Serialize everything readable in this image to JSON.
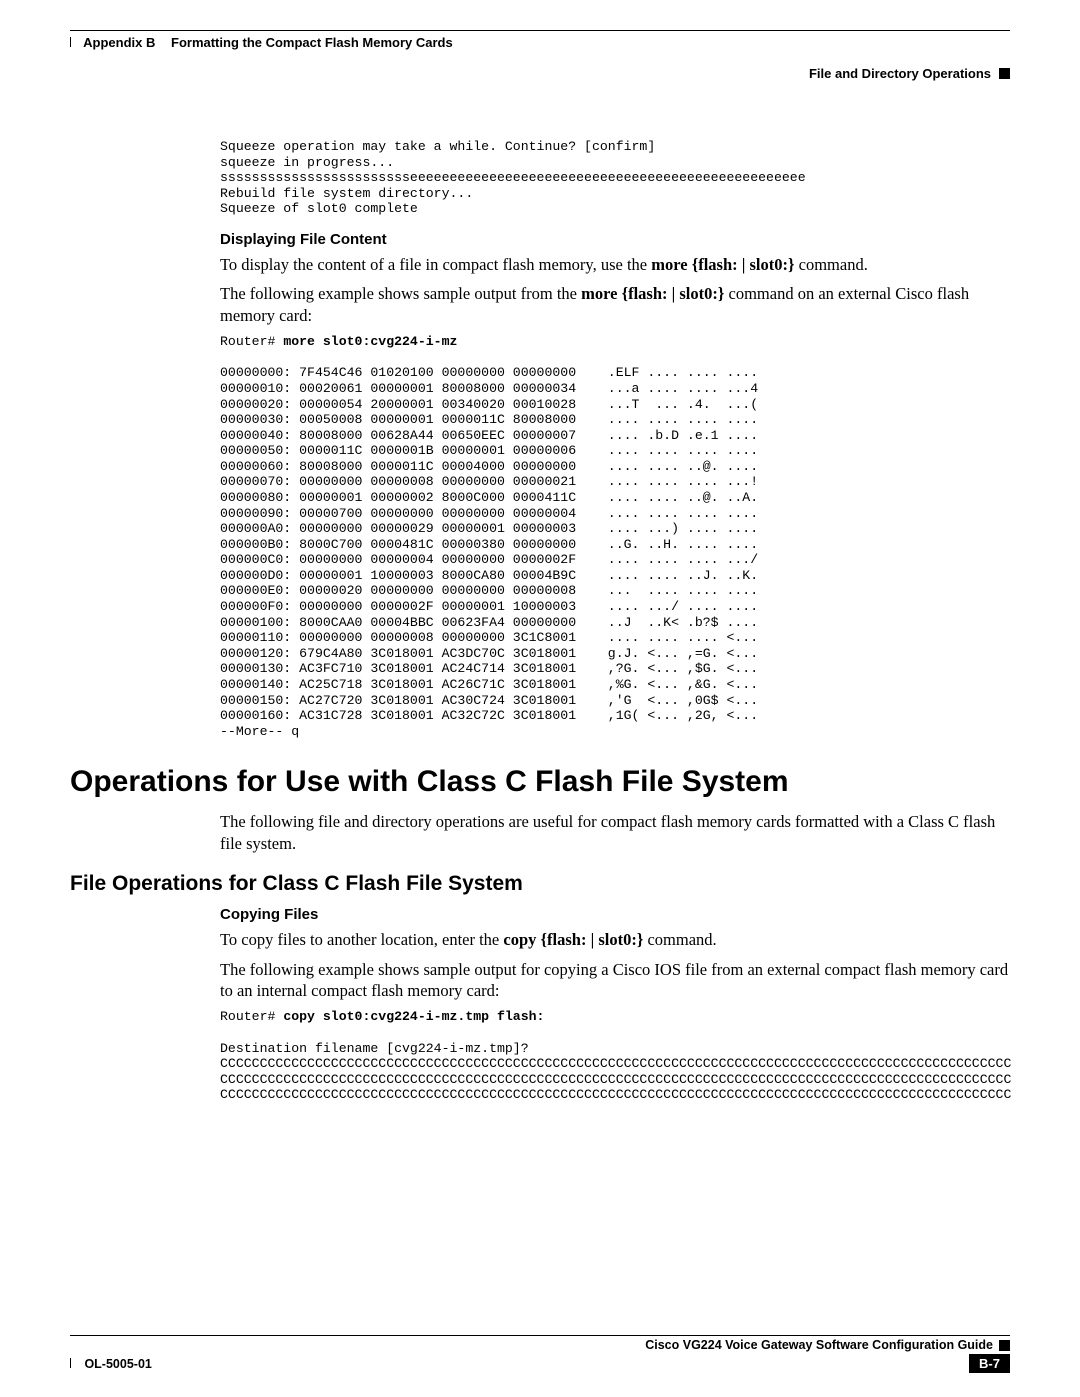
{
  "header": {
    "appendix": "Appendix B",
    "title": "Formatting the Compact Flash Memory Cards",
    "section_right": "File and Directory Operations"
  },
  "block1_term": "Squeeze operation may take a while. Continue? [confirm]\nsqueeze in progress...\nsssssssssssssssssssssssseeeeeeeeeeeeeeeeeeeeeeeeeeeeeeeeeeeeeeeeeeeeeeeeee\nRebuild file system directory...\nSqueeze of slot0 complete",
  "displaying": {
    "heading": "Displaying File Content",
    "p1_pre": "To display the content of a file in compact flash memory, use the ",
    "p1_cmd": "more {flash: | slot0:}",
    "p1_post": " command.",
    "p2_pre": "The following example shows sample output from the ",
    "p2_cmd": "more {flash: | slot0:}",
    "p2_post": " command on an external Cisco flash memory card:",
    "prompt": "Router# ",
    "cmd": "more slot0:cvg224-i-mz",
    "dump": "00000000: 7F454C46 01020100 00000000 00000000    .ELF .... .... ....\n00000010: 00020061 00000001 80008000 00000034    ...a .... .... ...4\n00000020: 00000054 20000001 00340020 00010028    ...T  ... .4.  ...(\n00000030: 00050008 00000001 0000011C 80008000    .... .... .... ....\n00000040: 80008000 00628A44 00650EEC 00000007    .... .b.D .e.1 ....\n00000050: 0000011C 0000001B 00000001 00000006    .... .... .... ....\n00000060: 80008000 0000011C 00004000 00000000    .... .... ..@. ....\n00000070: 00000000 00000008 00000000 00000021    .... .... .... ...!\n00000080: 00000001 00000002 8000C000 0000411C    .... .... ..@. ..A.\n00000090: 00000700 00000000 00000000 00000004    .... .... .... ....\n000000A0: 00000000 00000029 00000001 00000003    .... ...) .... ....\n000000B0: 8000C700 0000481C 00000380 00000000    ..G. ..H. .... ....\n000000C0: 00000000 00000004 00000000 0000002F    .... .... .... .../\n000000D0: 00000001 10000003 8000CA80 00004B9C    .... .... ..J. ..K.\n000000E0: 00000020 00000000 00000000 00000008    ...  .... .... ....\n000000F0: 00000000 0000002F 00000001 10000003    .... .../ .... ....\n00000100: 8000CAA0 00004BBC 00623FA4 00000000    ..J  ..K< .b?$ ....\n00000110: 00000000 00000008 00000000 3C1C8001    .... .... .... <...\n00000120: 679C4A80 3C018001 AC3DC70C 3C018001    g.J. <... ,=G. <...\n00000130: AC3FC710 3C018001 AC24C714 3C018001    ,?G. <... ,$G. <...\n00000140: AC25C718 3C018001 AC26C71C 3C018001    ,%G. <... ,&G. <...\n00000150: AC27C720 3C018001 AC30C724 3C018001    ,'G  <... ,0G$ <...\n00000160: AC31C728 3C018001 AC32C72C 3C018001    ,1G( <... ,2G, <...\n--More-- q"
  },
  "ops_heading": "Operations for Use with Class C Flash File System",
  "ops_intro": "The following file and directory operations are useful for compact flash memory cards formatted with a Class C flash file system.",
  "fileops_heading": "File Operations for Class C Flash File System",
  "copying": {
    "heading": "Copying Files",
    "p1_pre": "To copy files to another location, enter the ",
    "p1_cmd": "copy {flash: | slot0:}",
    "p1_post": " command.",
    "p2": "The following example shows sample output for copying a Cisco IOS file from an external compact flash memory card to an internal compact flash memory card:",
    "prompt": "Router# ",
    "cmd": "copy slot0:cvg224-i-mz.tmp flash:",
    "out": "Destination filename [cvg224-i-mz.tmp]?\nCCCCCCCCCCCCCCCCCCCCCCCCCCCCCCCCCCCCCCCCCCCCCCCCCCCCCCCCCCCCCCCCCCCCCCCCCCCCCCCCCCCCCCCCCCCCCCCCCCCC\nCCCCCCCCCCCCCCCCCCCCCCCCCCCCCCCCCCCCCCCCCCCCCCCCCCCCCCCCCCCCCCCCCCCCCCCCCCCCCCCCCCCCCCCCCCCCCCCCCCCC\nCCCCCCCCCCCCCCCCCCCCCCCCCCCCCCCCCCCCCCCCCCCCCCCCCCCCCCCCCCCCCCCCCCCCCCCCCCCCCCCCCCCCCCCCCCCCCCCCCCCC"
  },
  "footer": {
    "guide": "Cisco VG224 Voice Gateway Software Configuration Guide",
    "docnum": "OL-5005-01",
    "page": "B-7"
  }
}
